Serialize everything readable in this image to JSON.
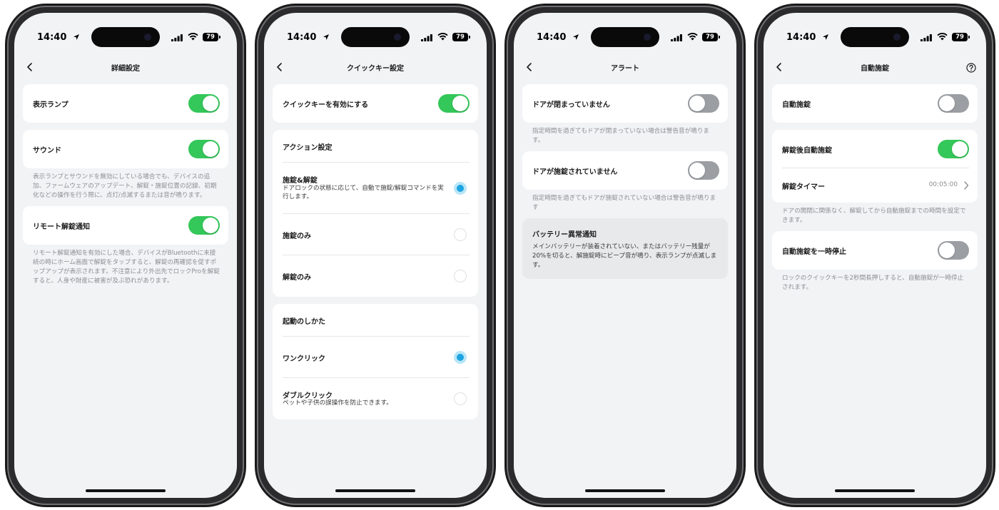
{
  "status": {
    "time": "14:40",
    "battery": "79"
  },
  "screen1": {
    "title": "詳細設定",
    "lamp": "表示ランプ",
    "sound": "サウンド",
    "note1": "表示ランプとサウンドを無効にしている場合でも、デバイスの追加、ファームウェアのアップデート、解錠・施錠位置の記録、初期化などの操作を行う際に、点灯/点滅するまたは音が鳴ります。",
    "remote": "リモート解錠通知",
    "note2": "リモート解錠通知を有効にした場合、デバイスがBluetoothに未接続の時にホーム画面で解錠をタップすると、解錠の再確認を促すポップアップが表示されます。不注意により外出先でロックProを解錠すると、人身や財産に被害が及ぶ恐れがあります。"
  },
  "screen2": {
    "title": "クイックキー設定",
    "enable": "クイックキーを有効にする",
    "action_header": "アクション設定",
    "opt1_label": "施錠&解錠",
    "opt1_desc": "ドアロックの状態に応じて、自動で施錠/解錠コマンドを実行します。",
    "opt2_label": "施錠のみ",
    "opt3_label": "解錠のみ",
    "trigger_header": "起動のしかた",
    "opt4_label": "ワンクリック",
    "opt5_label": "ダブルクリック",
    "opt5_desc": "ペットや子供の誤操作を防止できます。"
  },
  "screen3": {
    "title": "アラート",
    "door_open": "ドアが閉まっていません",
    "note1": "指定時間を過ぎてもドアが閉まっていない場合は警告音が鳴ります。",
    "door_unlocked": "ドアが施錠されていません",
    "note2": "指定時間を過ぎてもドアが施錠されていない場合は警告音が鳴ります",
    "battery_title": "バッテリー異常通知",
    "battery_desc": "メインバッテリーが装着されていない、またはバッテリー残量が20%を切ると、解施錠時にビープ音が鳴り、表示ランプが点滅します。"
  },
  "screen4": {
    "title": "自動施錠",
    "auto_lock": "自動施錠",
    "after_unlock": "解錠後自動施錠",
    "timer_label": "解錠タイマー",
    "timer_value": "00:05:00",
    "note1": "ドアの開閉に関係なく、解錠してから自動施錠までの時間を設定できます。",
    "pause": "自動施錠を一時停止",
    "note2": "ロックのクイックキーを2秒間長押しすると、自動施錠が一時停止されます。"
  }
}
